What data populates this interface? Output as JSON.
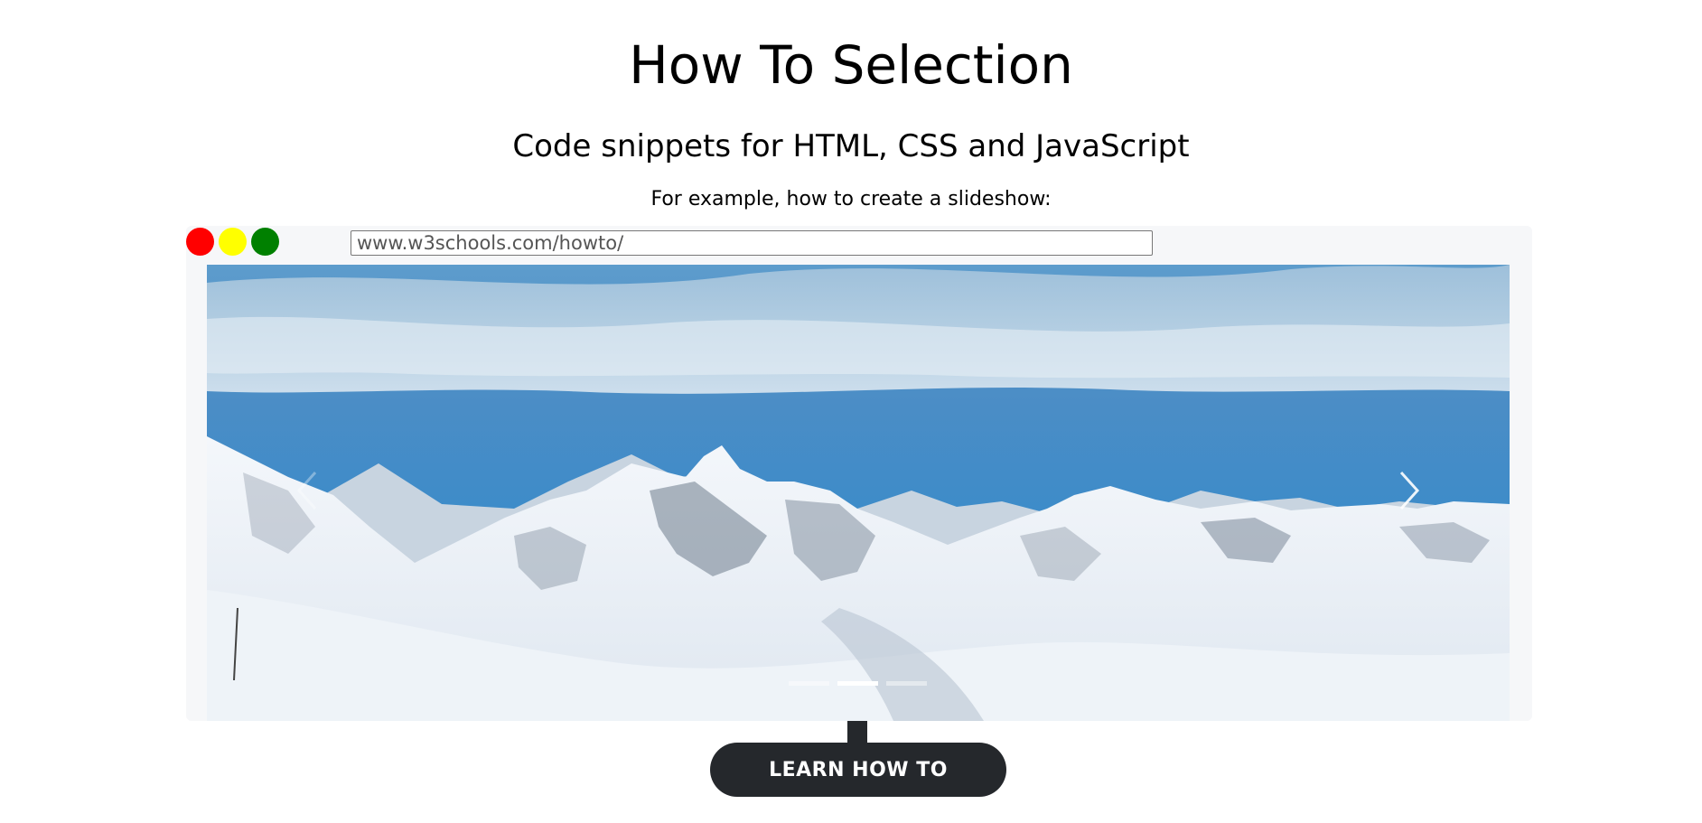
{
  "header": {
    "title": "How To Selection",
    "subtitle": "Code snippets for HTML, CSS and JavaScript",
    "example_text": "For example, how to create a slideshow:"
  },
  "browser_mock": {
    "url_value": "www.w3schools.com/howto/",
    "dots": [
      {
        "name": "red",
        "color": "#ff0000"
      },
      {
        "name": "yellow",
        "color": "#ffff00"
      },
      {
        "name": "green",
        "color": "#008000"
      }
    ]
  },
  "slideshow": {
    "prev_icon": "chevron-left-icon",
    "next_icon": "chevron-right-icon",
    "indicator_count": 3,
    "active_indicator": 2,
    "image_description": "snowy-mountains"
  },
  "cta": {
    "label": "LEARN HOW TO",
    "color": "#25282c"
  }
}
